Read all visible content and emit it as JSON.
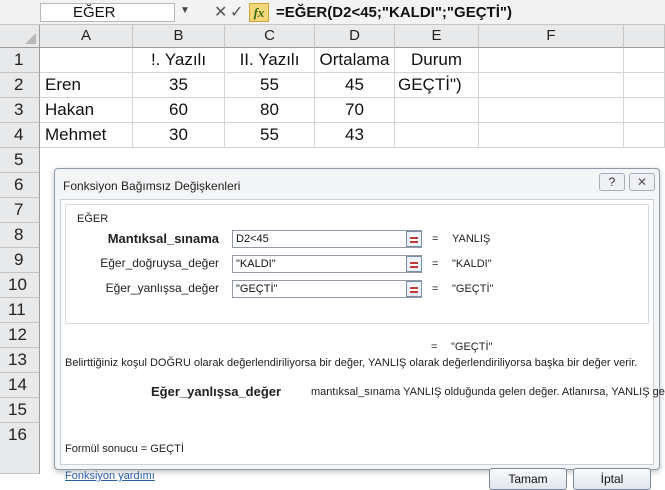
{
  "formula_bar": {
    "name_box": "EĞER",
    "fx": "fx",
    "formula": "=EĞER(D2<45;\"KALDI\";\"GEÇTİ\")"
  },
  "columns": [
    "A",
    "B",
    "C",
    "D",
    "E",
    "F"
  ],
  "rows": [
    "1",
    "2",
    "3",
    "4",
    "5",
    "6",
    "7",
    "8",
    "9",
    "10",
    "11",
    "12",
    "13",
    "14",
    "15",
    "16"
  ],
  "cells": {
    "r1": [
      "",
      "!. Yazılı",
      "II. Yazılı",
      "Ortalama",
      "Durum"
    ],
    "r2": [
      "Eren",
      "35",
      "55",
      "45",
      "GEÇTİ\")"
    ],
    "r3": [
      "Hakan",
      "60",
      "80",
      "70",
      ""
    ],
    "r4": [
      "Mehmet",
      "30",
      "55",
      "43",
      ""
    ]
  },
  "dialog": {
    "title": "Fonksiyon Bağımsız Değişkenleri",
    "help": "?",
    "close": "✕",
    "function_name": "EĞER",
    "args": [
      {
        "label": "Mantıksal_sınama",
        "value": "D2<45",
        "result": "YANLIŞ"
      },
      {
        "label": "Eğer_doğruysa_değer",
        "value": "\"KALDI\"",
        "result": "\"KALDI\""
      },
      {
        "label": "Eğer_yanlışsa_değer",
        "value": "\"GEÇTİ\"",
        "result": "\"GEÇTİ\""
      }
    ],
    "eq": "=",
    "formula_result_value": "\"GEÇTİ\"",
    "description": "Belirttiğiniz koşul DOĞRU olarak değerlendiriliyorsa bir değer, YANLIŞ olarak değerlendiriliyorsa başka bir değer verir.",
    "arg_desc_name": "Eğer_yanlışsa_değer",
    "arg_desc_text": "mantıksal_sınama YANLIŞ olduğunda gelen değer. Atlanırsa, YANLIŞ gelir.",
    "result_text": "Formül sonucu =  GEÇTİ",
    "help_link": "Fonksiyon yardımı",
    "ok": "Tamam",
    "cancel": "İptal"
  }
}
